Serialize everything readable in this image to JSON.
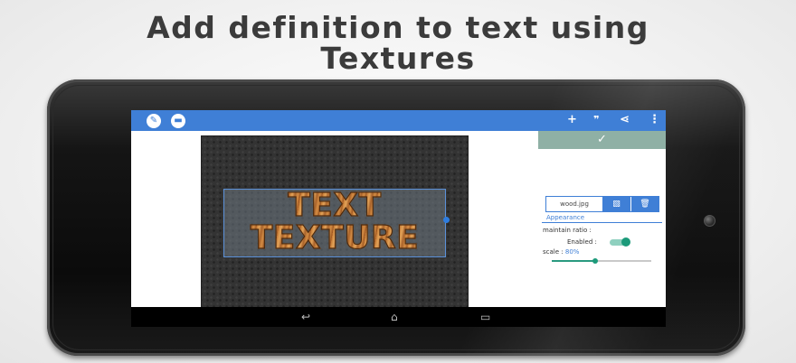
{
  "headline": {
    "line1": "Add definition to text using",
    "line2": "Textures"
  },
  "appbar": {
    "left_icons": [
      "pencil-icon",
      "trash-icon"
    ],
    "actions": [
      {
        "name": "add-icon",
        "glyph": "+"
      },
      {
        "name": "quote-icon",
        "glyph": "❞"
      },
      {
        "name": "share-icon",
        "glyph": "⋖"
      },
      {
        "name": "overflow-menu-icon",
        "glyph": "⋮"
      }
    ],
    "color": "#3f7fd6"
  },
  "canvas": {
    "text_lines": [
      "TEXT",
      "TEXTURE"
    ]
  },
  "panel": {
    "confirm_glyph": "✓",
    "texture_file": "wood.jpg",
    "image_button_glyph": "▧",
    "delete_button_glyph": "🗑",
    "appearance_label": "Appearance",
    "maintain_ratio_label": "maintain ratio :",
    "enabled_label": "Enabled :",
    "enabled": true,
    "scale_label": "scale : ",
    "scale_value": "80%",
    "slider_fraction": 0.44,
    "accent_color": "#1c9a7a"
  },
  "navbar": {
    "back_glyph": "↩",
    "home_glyph": "⌂",
    "recents_glyph": "▭"
  }
}
